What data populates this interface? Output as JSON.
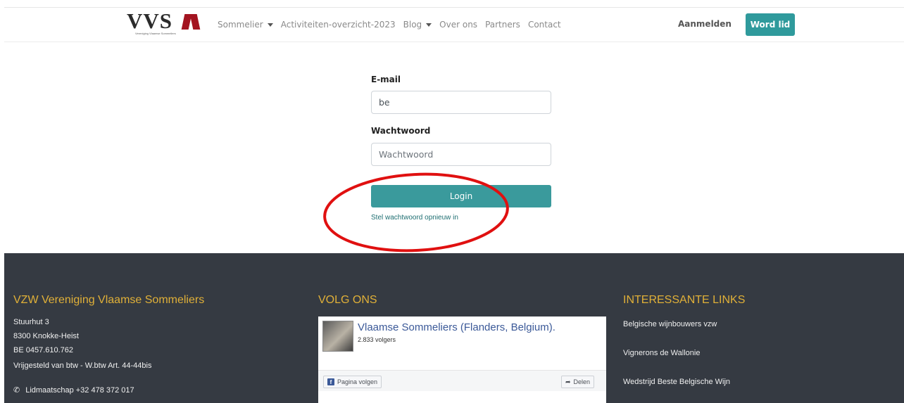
{
  "header": {
    "logo_text": "VVS",
    "logo_subtitle": "Vereniging Vlaamse Sommeliers",
    "nav": [
      {
        "label": "Sommelier",
        "dropdown": true
      },
      {
        "label": "Activiteiten-overzicht-2023",
        "dropdown": false
      },
      {
        "label": "Blog",
        "dropdown": true
      },
      {
        "label": "Over ons",
        "dropdown": false
      },
      {
        "label": "Partners",
        "dropdown": false
      },
      {
        "label": "Contact",
        "dropdown": false
      }
    ],
    "signin_label": "Aanmelden",
    "join_label": "Word lid"
  },
  "login": {
    "email_label": "E-mail",
    "email_value": "be",
    "password_label": "Wachtwoord",
    "password_placeholder": "Wachtwoord",
    "login_label": "Login",
    "reset_link": "Stel wachtwoord opnieuw in"
  },
  "footer": {
    "org": {
      "title": "VZW Vereniging Vlaamse Sommeliers",
      "lines": [
        "Stuurhut 3",
        "8300 Knokke-Heist",
        "BE 0457.610.762",
        "Vrijgesteld van btw - W.btw Art. 44-44bis"
      ],
      "phone": "Lidmaatschap +32 478 372 017"
    },
    "follow": {
      "title": "VOLG ONS",
      "page_name": "Vlaamse Sommeliers (Flanders, Belgium).",
      "followers": "2.833 volgers",
      "follow_btn": "Pagina volgen",
      "share_btn": "Delen"
    },
    "links": {
      "title": "INTERESSANTE LINKS",
      "items": [
        "Belgische wijnbouwers vzw",
        "Vignerons de Wallonie",
        "Wedstrijd Beste Belgische Wijn"
      ]
    }
  },
  "colors": {
    "accent": "#2f9a9c",
    "footer_bg": "#353a42",
    "footer_title": "#e0b038",
    "annotation": "#e01010"
  }
}
